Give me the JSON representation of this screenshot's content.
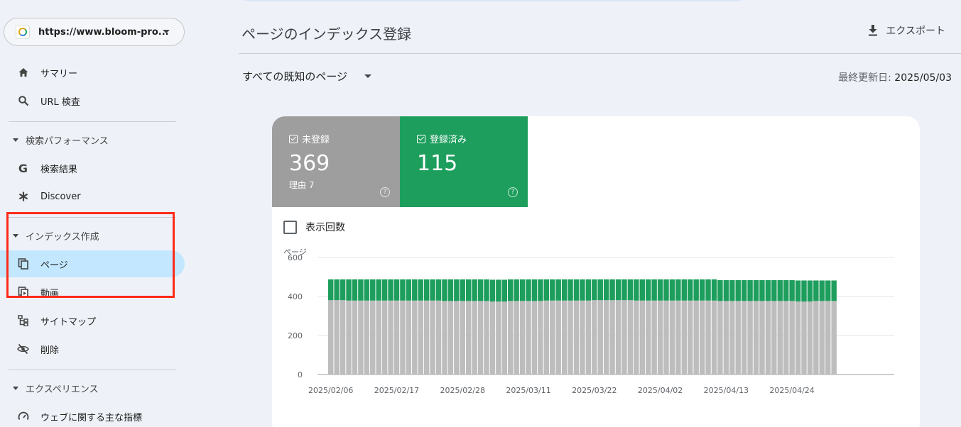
{
  "sidebar": {
    "property": "https://www.bloom-pro...",
    "items": [
      {
        "label": "サマリー",
        "icon": "home-icon"
      },
      {
        "label": "URL 検査",
        "icon": "search-icon"
      }
    ],
    "sections": [
      {
        "label": "検索パフォーマンス",
        "items": [
          {
            "label": "検索結果",
            "icon": "google-g-icon"
          },
          {
            "label": "Discover",
            "icon": "asterisk-icon"
          }
        ]
      },
      {
        "label": "インデックス作成",
        "items": [
          {
            "label": "ページ",
            "icon": "pages-icon",
            "active": true
          },
          {
            "label": "動画",
            "icon": "video-icon"
          },
          {
            "label": "サイトマップ",
            "icon": "sitemap-icon"
          },
          {
            "label": "削除",
            "icon": "visibility-off-icon"
          }
        ]
      },
      {
        "label": "エクスペリエンス",
        "items": [
          {
            "label": "ウェブに関する主な指標",
            "icon": "speed-icon"
          }
        ]
      }
    ]
  },
  "header": {
    "title": "ページのインデックス登録",
    "export_label": "エクスポート",
    "filter": "すべての既知のページ",
    "updated_label": "最終更新日: ",
    "updated_value": "2025/05/03"
  },
  "tiles": {
    "not_indexed": {
      "label": "未登録",
      "value": "369",
      "sub": "理由 7",
      "color": "#9e9e9e"
    },
    "indexed": {
      "label": "登録済み",
      "value": "115",
      "color": "#1e9e5d"
    }
  },
  "impressions_label": "表示回数",
  "chart_data": {
    "type": "bar",
    "stacked": true,
    "ylabel": "ページ",
    "ylim": [
      0,
      600
    ],
    "yticks": [
      0,
      200,
      400,
      600
    ],
    "xticks": [
      "2025/02/06",
      "2025/02/17",
      "2025/02/28",
      "2025/03/11",
      "2025/03/22",
      "2025/04/02",
      "2025/04/13",
      "2025/04/24"
    ],
    "x_start": "2025/02/06",
    "series": [
      {
        "name": "未登録",
        "color": "#bdbdbd",
        "values": [
          381,
          381,
          381,
          379,
          379,
          379,
          379,
          379,
          379,
          379,
          379,
          379,
          379,
          379,
          379,
          379,
          379,
          379,
          379,
          377,
          377,
          377,
          377,
          377,
          377,
          377,
          377,
          374,
          374,
          374,
          377,
          377,
          377,
          377,
          377,
          377,
          379,
          379,
          379,
          379,
          379,
          379,
          379,
          379,
          381,
          381,
          381,
          381,
          381,
          381,
          381,
          379,
          379,
          379,
          379,
          379,
          379,
          379,
          379,
          379,
          379,
          379,
          379,
          379,
          379,
          377,
          377,
          377,
          377,
          377,
          377,
          377,
          377,
          377,
          377,
          377,
          377,
          377,
          374,
          374,
          374,
          377,
          377,
          377,
          377
        ]
      },
      {
        "name": "登録済み",
        "color": "#1e9e5d",
        "values": [
          107,
          107,
          107,
          109,
          109,
          109,
          109,
          109,
          109,
          109,
          109,
          109,
          109,
          109,
          109,
          109,
          109,
          109,
          109,
          111,
          111,
          111,
          111,
          111,
          111,
          111,
          111,
          112,
          112,
          112,
          111,
          111,
          111,
          111,
          111,
          111,
          109,
          109,
          109,
          109,
          109,
          109,
          109,
          109,
          107,
          107,
          107,
          107,
          107,
          107,
          107,
          109,
          109,
          109,
          109,
          109,
          109,
          109,
          109,
          109,
          109,
          109,
          109,
          109,
          109,
          107,
          107,
          107,
          107,
          107,
          107,
          107,
          107,
          107,
          107,
          107,
          107,
          107,
          108,
          108,
          108,
          105,
          105,
          105,
          105
        ]
      }
    ]
  }
}
